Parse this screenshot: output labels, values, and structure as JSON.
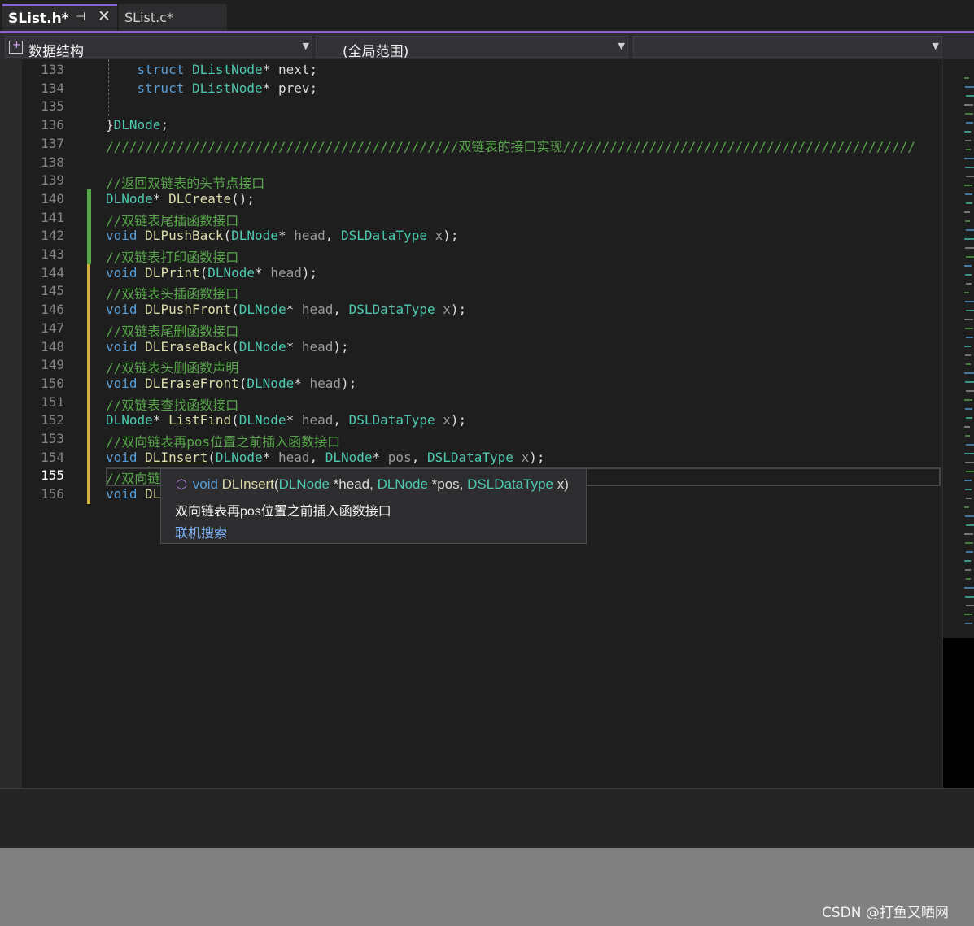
{
  "tabs": [
    {
      "label": "SList.h*",
      "active": true
    },
    {
      "label": "SList.c*",
      "active": false
    }
  ],
  "icons": {
    "pin": "pin-icon",
    "close": "close-icon",
    "project": "project-icon",
    "dropdown": "chevron-down-icon",
    "member": "cube-icon"
  },
  "navbar": {
    "project": "数据结构",
    "scope": "(全局范围)",
    "member": ""
  },
  "current_line": "155",
  "lines": [
    {
      "n": "133",
      "parts": [
        [
          "pl",
          "    "
        ],
        [
          "kw",
          "struct "
        ],
        [
          "ty",
          "DListNode"
        ],
        [
          "pl",
          "* "
        ],
        [
          "fi",
          "next"
        ],
        [
          "pl",
          ";"
        ]
      ]
    },
    {
      "n": "134",
      "parts": [
        [
          "pl",
          "    "
        ],
        [
          "kw",
          "struct "
        ],
        [
          "ty",
          "DListNode"
        ],
        [
          "pl",
          "* "
        ],
        [
          "fi",
          "prev"
        ],
        [
          "pl",
          ";"
        ]
      ]
    },
    {
      "n": "135",
      "parts": []
    },
    {
      "n": "136",
      "parts": [
        [
          "pl",
          "}"
        ],
        [
          "ty",
          "DLNode"
        ],
        [
          "pl",
          ";"
        ]
      ]
    },
    {
      "n": "137",
      "parts": [
        [
          "cm",
          "/////////////////////////////////////////////双链表的接口实现/////////////////////////////////////////////"
        ]
      ]
    },
    {
      "n": "138",
      "parts": []
    },
    {
      "n": "139",
      "parts": [
        [
          "cm",
          "//返回双链表的头节点接口"
        ]
      ]
    },
    {
      "n": "140",
      "parts": [
        [
          "ty",
          "DLNode"
        ],
        [
          "pl",
          "* "
        ],
        [
          "fn",
          "DLCreate"
        ],
        [
          "pl",
          "();"
        ]
      ]
    },
    {
      "n": "141",
      "parts": [
        [
          "cm",
          "//双链表尾插函数接口"
        ]
      ]
    },
    {
      "n": "142",
      "parts": [
        [
          "kw",
          "void "
        ],
        [
          "fn",
          "DLPushBack"
        ],
        [
          "pl",
          "("
        ],
        [
          "ty",
          "DLNode"
        ],
        [
          "pl",
          "* "
        ],
        [
          "pr",
          "head"
        ],
        [
          "pl",
          ", "
        ],
        [
          "ty",
          "DSLDataType"
        ],
        [
          "pl",
          " "
        ],
        [
          "pr",
          "x"
        ],
        [
          "pl",
          ");"
        ]
      ]
    },
    {
      "n": "143",
      "parts": [
        [
          "cm",
          "//双链表打印函数接口"
        ]
      ]
    },
    {
      "n": "144",
      "parts": [
        [
          "kw",
          "void "
        ],
        [
          "fn",
          "DLPrint"
        ],
        [
          "pl",
          "("
        ],
        [
          "ty",
          "DLNode"
        ],
        [
          "pl",
          "* "
        ],
        [
          "pr",
          "head"
        ],
        [
          "pl",
          ");"
        ]
      ]
    },
    {
      "n": "145",
      "parts": [
        [
          "cm",
          "//双链表头插函数接口"
        ]
      ]
    },
    {
      "n": "146",
      "parts": [
        [
          "kw",
          "void "
        ],
        [
          "fn",
          "DLPushFront"
        ],
        [
          "pl",
          "("
        ],
        [
          "ty",
          "DLNode"
        ],
        [
          "pl",
          "* "
        ],
        [
          "pr",
          "head"
        ],
        [
          "pl",
          ", "
        ],
        [
          "ty",
          "DSLDataType"
        ],
        [
          "pl",
          " "
        ],
        [
          "pr",
          "x"
        ],
        [
          "pl",
          ");"
        ]
      ]
    },
    {
      "n": "147",
      "parts": [
        [
          "cm",
          "//双链表尾删函数接口"
        ]
      ]
    },
    {
      "n": "148",
      "parts": [
        [
          "kw",
          "void "
        ],
        [
          "fn",
          "DLEraseBack"
        ],
        [
          "pl",
          "("
        ],
        [
          "ty",
          "DLNode"
        ],
        [
          "pl",
          "* "
        ],
        [
          "pr",
          "head"
        ],
        [
          "pl",
          ");"
        ]
      ]
    },
    {
      "n": "149",
      "parts": [
        [
          "cm",
          "//双链表头删函数声明"
        ]
      ]
    },
    {
      "n": "150",
      "parts": [
        [
          "kw",
          "void "
        ],
        [
          "fn",
          "DLEraseFront"
        ],
        [
          "pl",
          "("
        ],
        [
          "ty",
          "DLNode"
        ],
        [
          "pl",
          "* "
        ],
        [
          "pr",
          "head"
        ],
        [
          "pl",
          ");"
        ]
      ]
    },
    {
      "n": "151",
      "parts": [
        [
          "cm",
          "//双链表查找函数接口"
        ]
      ]
    },
    {
      "n": "152",
      "parts": [
        [
          "ty",
          "DLNode"
        ],
        [
          "pl",
          "* "
        ],
        [
          "fn",
          "ListFind"
        ],
        [
          "pl",
          "("
        ],
        [
          "ty",
          "DLNode"
        ],
        [
          "pl",
          "* "
        ],
        [
          "pr",
          "head"
        ],
        [
          "pl",
          ", "
        ],
        [
          "ty",
          "DSLDataType"
        ],
        [
          "pl",
          " "
        ],
        [
          "pr",
          "x"
        ],
        [
          "pl",
          ");"
        ]
      ]
    },
    {
      "n": "153",
      "parts": [
        [
          "cm",
          "//双向链表再pos位置之前插入函数接口"
        ]
      ]
    },
    {
      "n": "154",
      "parts": [
        [
          "kw",
          "void "
        ],
        [
          "fn ul",
          "DLInsert"
        ],
        [
          "pl",
          "("
        ],
        [
          "ty",
          "DLNode"
        ],
        [
          "pl",
          "* "
        ],
        [
          "pr",
          "head"
        ],
        [
          "pl",
          ", "
        ],
        [
          "ty",
          "DLNode"
        ],
        [
          "pl",
          "* "
        ],
        [
          "pr",
          "pos"
        ],
        [
          "pl",
          ", "
        ],
        [
          "ty",
          "DSLDataType"
        ],
        [
          "pl",
          " "
        ],
        [
          "pr",
          "x"
        ],
        [
          "pl",
          ");"
        ]
      ]
    },
    {
      "n": "155",
      "parts": [
        [
          "cm",
          "//双向链"
        ]
      ]
    },
    {
      "n": "156",
      "parts": [
        [
          "kw",
          "void "
        ],
        [
          "fn",
          "DL"
        ]
      ]
    }
  ],
  "tooltip": {
    "signature": [
      [
        "kw",
        "void "
      ],
      [
        "fn",
        "DLInsert"
      ],
      [
        "pl",
        "("
      ],
      [
        "ty",
        "DLNode"
      ],
      [
        "pl",
        " *head, "
      ],
      [
        "ty",
        "DLNode"
      ],
      [
        "pl",
        " *pos, "
      ],
      [
        "ty",
        "DSLDataType"
      ],
      [
        "pl",
        " x)"
      ]
    ],
    "description": "双向链表再pos位置之前插入函数接口",
    "link": "联机搜索"
  },
  "watermark": "CSDN @打鱼又晒网"
}
